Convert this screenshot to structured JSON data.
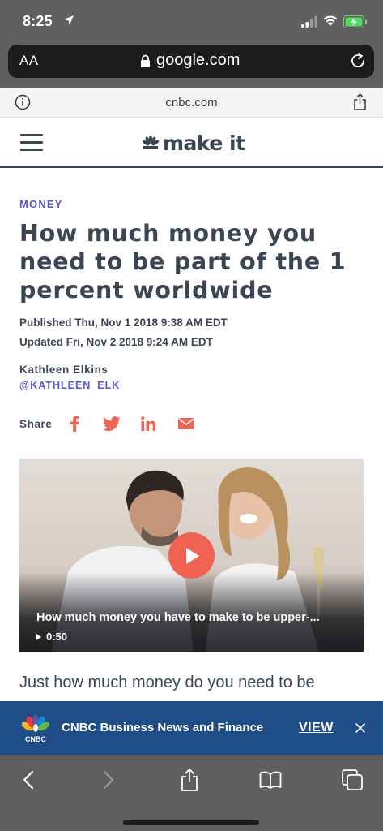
{
  "status_bar": {
    "time": "8:25",
    "icons": [
      "location-arrow-icon",
      "signal-icon",
      "wifi-icon",
      "battery-charging-icon"
    ]
  },
  "browser": {
    "text_size_button": "AA",
    "url": "google.com",
    "amp_domain": "cnbc.com"
  },
  "site": {
    "logo_text": "make it",
    "colors": {
      "header_text": "#3c4554",
      "accent_purple": "#5a55d6",
      "share_red": "#f06252",
      "banner_blue": "#1f4d88"
    }
  },
  "article": {
    "section": "MONEY",
    "headline": "How much money you need to be part of the 1 percent worldwide",
    "published": "Published Thu, Nov 1 2018 9:38 AM EDT",
    "updated": "Updated Fri, Nov 2 2018 9:24 AM EDT",
    "author": "Kathleen Elkins",
    "author_handle": "@KATHLEEN_ELK",
    "share_label": "Share",
    "share_buttons": [
      "facebook-icon",
      "twitter-icon",
      "linkedin-icon",
      "email-icon"
    ],
    "body_start": "Just how much money do you need to be"
  },
  "video": {
    "title": "How much money you have to make to be upper-...",
    "duration": "0:50"
  },
  "app_banner": {
    "logo_text": "CNBC",
    "title": "CNBC Business News and Finance",
    "action": "VIEW"
  },
  "toolbar": {
    "buttons": [
      "back-icon",
      "forward-icon",
      "share-icon",
      "bookmarks-icon",
      "tabs-icon"
    ]
  }
}
